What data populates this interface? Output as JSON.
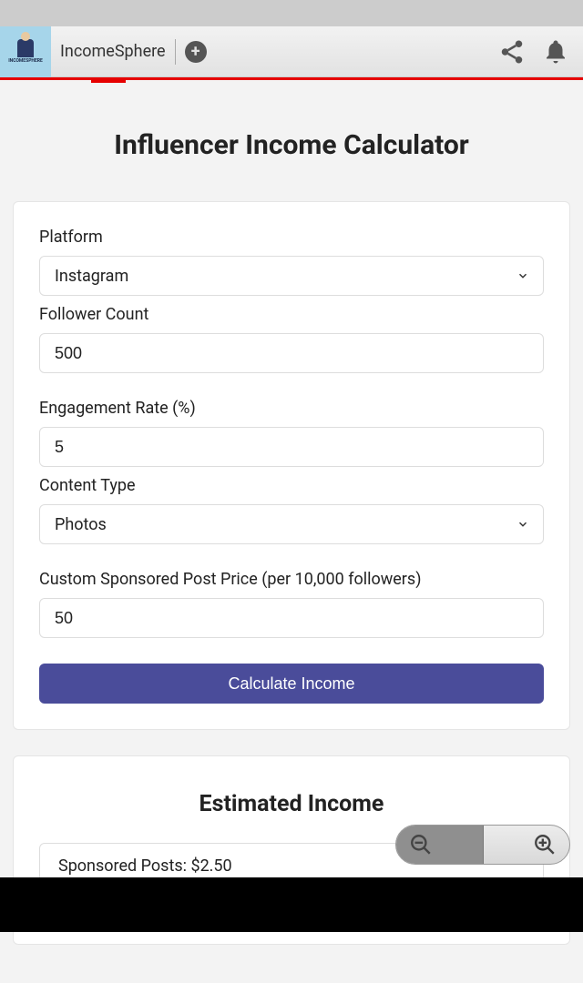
{
  "topbar": {
    "app_name": "IncomeSphere"
  },
  "page": {
    "title": "Influencer Income Calculator"
  },
  "form": {
    "platform_label": "Platform",
    "platform_value": "Instagram",
    "follower_label": "Follower Count",
    "follower_value": "500",
    "engagement_label": "Engagement Rate (%)",
    "engagement_value": "5",
    "content_type_label": "Content Type",
    "content_type_value": "Photos",
    "custom_price_label": "Custom Sponsored Post Price (per 10,000 followers)",
    "custom_price_value": "50",
    "calculate_label": "Calculate Income"
  },
  "results": {
    "title": "Estimated Income",
    "sponsored_posts": "Sponsored Posts: $2.50"
  }
}
